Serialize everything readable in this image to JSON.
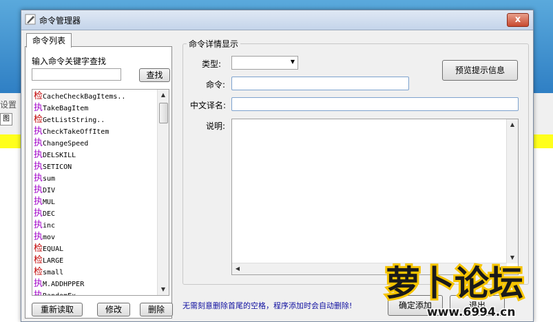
{
  "background": {
    "menu_tab": "设置",
    "toolbar_glyph": "图"
  },
  "dialog": {
    "title": "命令管理器",
    "close_label": "x"
  },
  "left_panel": {
    "tab_label": "命令列表",
    "search_label": "输入命令关键字查找",
    "search_value": "",
    "find_button": "查找",
    "items": [
      {
        "prefix": "检",
        "kind": "jian",
        "name": "CacheCheckBagItems.."
      },
      {
        "prefix": "执",
        "kind": "zhi",
        "name": "TakeBagItem"
      },
      {
        "prefix": "检",
        "kind": "jian",
        "name": "GetListString.."
      },
      {
        "prefix": "执",
        "kind": "zhi",
        "name": "CheckTakeOffItem"
      },
      {
        "prefix": "执",
        "kind": "zhi",
        "name": "ChangeSpeed"
      },
      {
        "prefix": "执",
        "kind": "zhi",
        "name": "DELSKILL"
      },
      {
        "prefix": "执",
        "kind": "zhi",
        "name": "SETICON"
      },
      {
        "prefix": "执",
        "kind": "zhi",
        "name": "sum"
      },
      {
        "prefix": "执",
        "kind": "zhi",
        "name": "DIV"
      },
      {
        "prefix": "执",
        "kind": "zhi",
        "name": "MUL"
      },
      {
        "prefix": "执",
        "kind": "zhi",
        "name": "DEC"
      },
      {
        "prefix": "执",
        "kind": "zhi",
        "name": "inc"
      },
      {
        "prefix": "执",
        "kind": "zhi",
        "name": "mov"
      },
      {
        "prefix": "检",
        "kind": "jian",
        "name": "EQUAL"
      },
      {
        "prefix": "检",
        "kind": "jian",
        "name": "LARGE"
      },
      {
        "prefix": "检",
        "kind": "jian",
        "name": "small"
      },
      {
        "prefix": "执",
        "kind": "zhi",
        "name": "M.ADDHPPER"
      },
      {
        "prefix": "执",
        "kind": "zhi",
        "name": "RandomEx"
      }
    ],
    "reload_button": "重新读取",
    "edit_button": "修改",
    "delete_button": "删除"
  },
  "details": {
    "group_title": "命令详情显示",
    "type_label": "类型:",
    "type_value": "",
    "command_label": "命令:",
    "command_value": "",
    "cn_name_label": "中文译名:",
    "cn_name_value": "",
    "desc_label": "说明:",
    "desc_value": "",
    "preview_button": "预览提示信息"
  },
  "footer": {
    "hint": "无需刻意删除首尾的空格，程序添加时会自动删除!",
    "ok_button": "确定添加",
    "cancel_button": "退出"
  },
  "watermark": {
    "text": "萝卜论坛",
    "url": "www.6994.cn"
  },
  "colors": {
    "jian_prefix": "#c00000",
    "zhi_prefix": "#a000c8",
    "hint_text": "#1010a0"
  }
}
